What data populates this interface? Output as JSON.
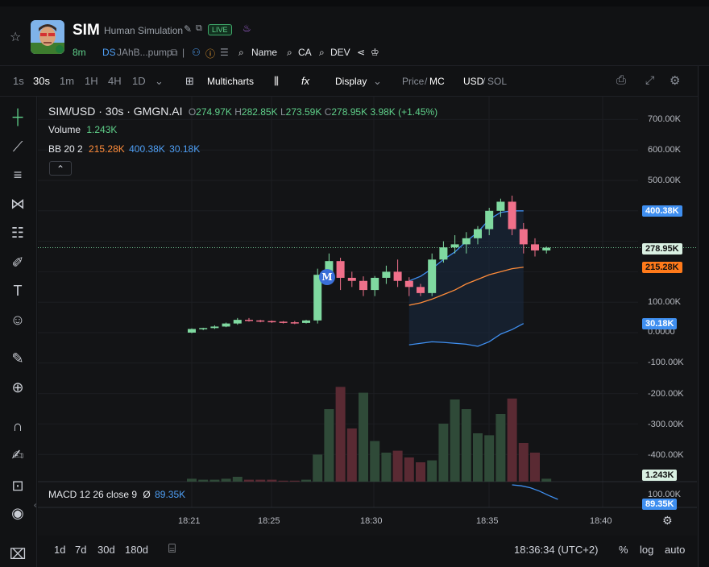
{
  "token": {
    "symbol": "SIM",
    "name": "Human Simulation",
    "live_label": "LIVE",
    "age": "8m",
    "ds_label": "DS",
    "address": "JAhB...pump",
    "name_search": "Name",
    "ca_search": "CA",
    "dev_search": "DEV"
  },
  "toolbar": {
    "intervals": [
      "1s",
      "30s",
      "1m",
      "1H",
      "4H",
      "1D"
    ],
    "active_interval": "30s",
    "multicharts": "Multicharts",
    "fx": "fx",
    "display": "Display",
    "price": "Price",
    "mc": "MC",
    "usd": "USD",
    "sol": "SOL"
  },
  "legend": {
    "pair": "SIM/USD · 30s · GMGN.AI",
    "o_label": "O",
    "o_value": "274.97K",
    "h_label": "H",
    "h_value": "282.85K",
    "l_label": "L",
    "l_value": "273.59K",
    "c_label": "C",
    "c_value": "278.95K",
    "change": "3.98K (+1.45%)",
    "volume_label": "Volume",
    "volume_value": "1.243K",
    "bb_label": "BB 20 2",
    "bb_mid": "215.28K",
    "bb_upper": "400.38K",
    "bb_lower": "30.18K",
    "macd_label": "MACD 12 26 close 9",
    "macd_sym": "Ø",
    "macd_value": "89.35K",
    "collapse": "⌃"
  },
  "price_axis": {
    "ticks": [
      "700.00K",
      "600.00K",
      "500.00K",
      "100.00K",
      "0.0000",
      "-100.00K",
      "-200.00K",
      "-300.00K",
      "-400.00K"
    ],
    "tag_upper": "400.38K",
    "tag_current": "278.95K",
    "tag_mid": "215.28K",
    "tag_lower": "30.18K",
    "tag_volume": "1.243K",
    "tag_macd": "89.35K",
    "macd_top_tick": "100.00K"
  },
  "time_axis": [
    "18:21",
    "18:25",
    "18:30",
    "18:35",
    "18:40"
  ],
  "marker": "M",
  "bottom": {
    "ranges": [
      "1d",
      "7d",
      "30d",
      "180d"
    ],
    "clock": "18:36:34 (UTC+2)",
    "percent": "%",
    "log": "log",
    "auto": "auto"
  },
  "colors": {
    "up": "#7fd9a0",
    "down": "#f0708a",
    "bb_mid": "#ff8c3a",
    "bb_band": "#3f8ff0",
    "bg": "#131416"
  },
  "chart_data": {
    "type": "candlestick",
    "candles": [
      {
        "o": 0,
        "h": 14,
        "l": -2,
        "c": 12
      },
      {
        "o": 12,
        "h": 16,
        "l": 8,
        "c": 15
      },
      {
        "o": 15,
        "h": 24,
        "l": 12,
        "c": 20
      },
      {
        "o": 20,
        "h": 33,
        "l": 18,
        "c": 30
      },
      {
        "o": 30,
        "h": 48,
        "l": 26,
        "c": 42
      },
      {
        "o": 42,
        "h": 48,
        "l": 36,
        "c": 40
      },
      {
        "o": 40,
        "h": 42,
        "l": 34,
        "c": 38
      },
      {
        "o": 38,
        "h": 40,
        "l": 32,
        "c": 36
      },
      {
        "o": 36,
        "h": 38,
        "l": 30,
        "c": 34
      },
      {
        "o": 34,
        "h": 38,
        "l": 28,
        "c": 32
      },
      {
        "o": 32,
        "h": 42,
        "l": 30,
        "c": 40
      },
      {
        "o": 40,
        "h": 210,
        "l": 30,
        "c": 190
      },
      {
        "o": 190,
        "h": 260,
        "l": 180,
        "c": 235
      },
      {
        "o": 235,
        "h": 246,
        "l": 140,
        "c": 180
      },
      {
        "o": 180,
        "h": 200,
        "l": 150,
        "c": 170
      },
      {
        "o": 170,
        "h": 185,
        "l": 120,
        "c": 140
      },
      {
        "o": 140,
        "h": 186,
        "l": 120,
        "c": 180
      },
      {
        "o": 180,
        "h": 220,
        "l": 160,
        "c": 200
      },
      {
        "o": 200,
        "h": 240,
        "l": 150,
        "c": 170
      },
      {
        "o": 170,
        "h": 182,
        "l": 120,
        "c": 150
      },
      {
        "o": 150,
        "h": 160,
        "l": 120,
        "c": 130
      },
      {
        "o": 130,
        "h": 260,
        "l": 120,
        "c": 240
      },
      {
        "o": 240,
        "h": 300,
        "l": 230,
        "c": 280
      },
      {
        "o": 280,
        "h": 320,
        "l": 260,
        "c": 290
      },
      {
        "o": 290,
        "h": 330,
        "l": 260,
        "c": 310
      },
      {
        "o": 310,
        "h": 350,
        "l": 290,
        "c": 340
      },
      {
        "o": 340,
        "h": 410,
        "l": 320,
        "c": 400
      },
      {
        "o": 400,
        "h": 440,
        "l": 380,
        "c": 430
      },
      {
        "o": 430,
        "h": 450,
        "l": 320,
        "c": 340
      },
      {
        "o": 340,
        "h": 360,
        "l": 260,
        "c": 290
      },
      {
        "o": 290,
        "h": 310,
        "l": 250,
        "c": 270
      },
      {
        "o": 270,
        "h": 283,
        "l": 260,
        "c": 279
      }
    ],
    "volume": [
      3,
      2,
      2,
      3,
      5,
      2,
      2,
      2,
      1,
      1,
      2,
      28,
      75,
      98,
      55,
      92,
      42,
      30,
      32,
      25,
      20,
      22,
      60,
      85,
      75,
      50,
      48,
      70,
      86,
      40,
      30,
      3
    ],
    "volume_dir": [
      "u",
      "u",
      "u",
      "u",
      "u",
      "d",
      "d",
      "d",
      "d",
      "d",
      "u",
      "u",
      "u",
      "d",
      "d",
      "u",
      "u",
      "u",
      "d",
      "d",
      "d",
      "u",
      "u",
      "u",
      "u",
      "u",
      "u",
      "u",
      "d",
      "d",
      "d",
      "u"
    ],
    "bb_start_index": 19,
    "bb_upper": [
      170,
      185,
      210,
      240,
      265,
      300,
      330,
      372,
      395,
      400,
      400
    ],
    "bb_mid": [
      90,
      98,
      110,
      125,
      140,
      160,
      175,
      190,
      200,
      210,
      215
    ],
    "bb_lower": [
      -40,
      -35,
      -30,
      -32,
      -35,
      -38,
      -45,
      -30,
      -5,
      10,
      30
    ],
    "macd": [
      40,
      38,
      34,
      27,
      18,
      10
    ]
  }
}
